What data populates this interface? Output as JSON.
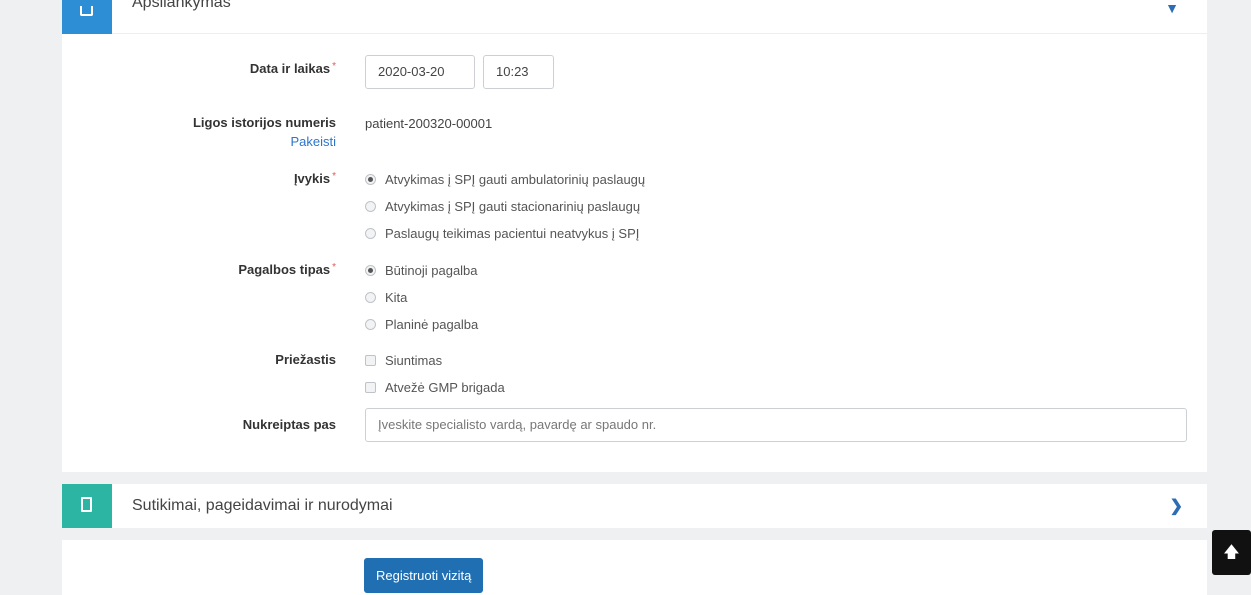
{
  "sections": {
    "visit": {
      "title": "Apsilankymas",
      "icon": "box-icon",
      "accent": "#2d8ed6"
    },
    "consents": {
      "title": "Sutikimai, pageidavimai ir nurodymai",
      "icon": "document-icon",
      "accent": "#2bb5a2"
    }
  },
  "form": {
    "datetime": {
      "label": "Data ir laikas",
      "required": "*",
      "date": "2020-03-20",
      "time": "10:23"
    },
    "history": {
      "label": "Ligos istorijos numeris",
      "change_link": "Pakeisti",
      "value": "patient-200320-00001"
    },
    "event": {
      "label": "Įvykis",
      "required": "*",
      "options": [
        {
          "label": "Atvykimas į SPĮ gauti ambulatorinių paslaugų",
          "selected": true
        },
        {
          "label": "Atvykimas į SPĮ gauti stacionarinių paslaugų",
          "selected": false
        },
        {
          "label": "Paslaugų teikimas pacientui neatvykus į SPĮ",
          "selected": false
        }
      ]
    },
    "help_type": {
      "label": "Pagalbos tipas",
      "required": "*",
      "options": [
        {
          "label": "Būtinoji pagalba",
          "selected": true
        },
        {
          "label": "Kita",
          "selected": false
        },
        {
          "label": "Planinė pagalba",
          "selected": false
        }
      ]
    },
    "reason": {
      "label": "Priežastis",
      "options": [
        {
          "label": "Siuntimas",
          "checked": false
        },
        {
          "label": "Atvežė GMP brigada",
          "checked": false
        }
      ]
    },
    "referred": {
      "label": "Nukreiptas pas",
      "placeholder": "Įveskite specialisto vardą, pavardę ar spaudo nr."
    }
  },
  "actions": {
    "submit_label": "Registruoti vizitą"
  },
  "colors": {
    "primary": "#1f6fb2",
    "required": "#e05a5a",
    "link": "#2d76c9"
  }
}
